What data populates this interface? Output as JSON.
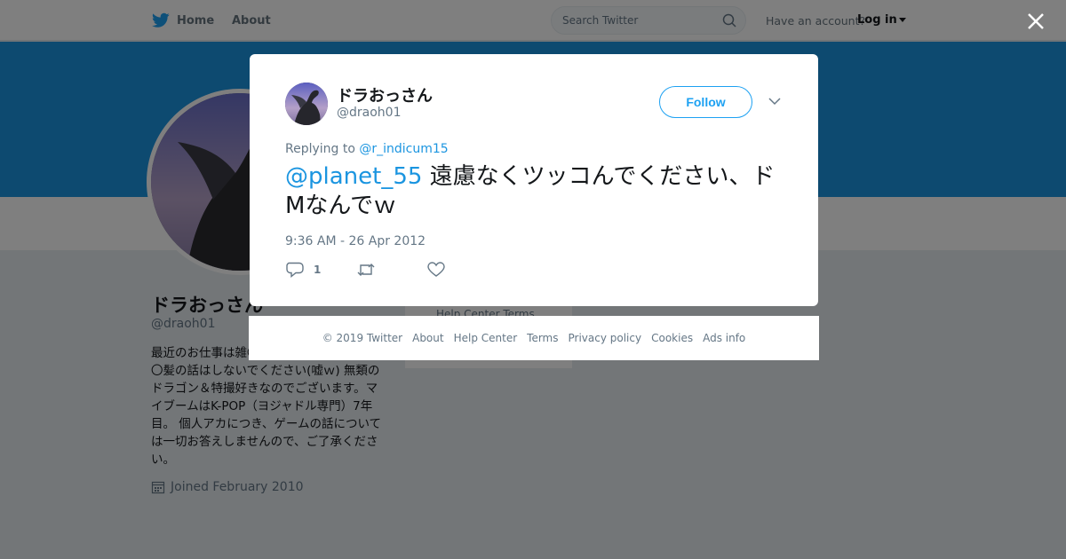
{
  "nav": {
    "home_label": "Home",
    "about_label": "About",
    "search_placeholder": "Search Twitter",
    "have_account": "Have an account?",
    "login_label": "Log in"
  },
  "profile": {
    "name": "ドラおっさん",
    "handle": "@draoh01",
    "bio": "最近のお仕事は雑〇〇〇〇〇〇〇〇〇〇〇〇髪の話はしないでください(嘘ｗ) 無類のドラゴン＆特撮好きなのでございます。マイブームはK-POP（ヨジャドル専門）7年目。 個人アカにつき、ゲームの話については一切お答えしませんので、ご了承ください。",
    "joined": "Joined February 2010"
  },
  "sidebar_links": "Help Center  Terms",
  "tweet": {
    "name": "ドラおっさん",
    "handle": "@draoh01",
    "follow_label": "Follow",
    "replying_prefix": "Replying to",
    "replying_to": "@r_indicum15",
    "mention": "@planet_55",
    "text": " 遠慮なくツッコんでください、ドMなんでｗ",
    "timestamp": "9:36 AM - 26 Apr 2012",
    "reply_count": "1"
  },
  "footer": {
    "copyright": "© 2019 Twitter",
    "links": [
      "About",
      "Help Center",
      "Terms",
      "Privacy policy",
      "Cookies",
      "Ads info"
    ]
  },
  "colors": {
    "brand_blue": "#1da1f2",
    "link_blue": "#1b95e0",
    "banner_blue": "#1b95e0",
    "muted_text": "#657786",
    "overlay": "rgba(0,0,0,0.5)"
  },
  "icons": [
    "twitter-bird-icon",
    "search-icon",
    "caret-down-icon",
    "close-icon",
    "calendar-icon",
    "chevron-down-icon",
    "reply-icon",
    "retweet-icon",
    "heart-icon"
  ]
}
